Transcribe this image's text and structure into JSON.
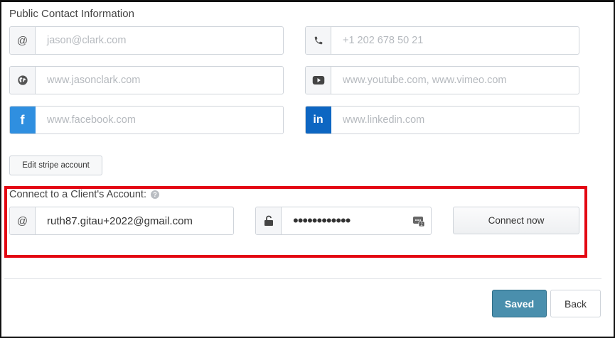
{
  "public_contact": {
    "title": "Public Contact Information",
    "email_placeholder": "jason@clark.com",
    "phone_placeholder": "+1 202 678 50 21",
    "website_placeholder": "www.jasonclark.com",
    "video_placeholder": "www.youtube.com, www.vimeo.com",
    "facebook_placeholder": "www.facebook.com",
    "linkedin_placeholder": "www.linkedin.com",
    "icons": {
      "email": "at-icon",
      "phone": "phone-icon",
      "website": "globe-icon",
      "video": "youtube-icon",
      "facebook": "facebook-icon",
      "linkedin": "linkedin-icon"
    }
  },
  "stripe": {
    "edit_label": "Edit stripe account"
  },
  "connect": {
    "label": "Connect to a Client's Account:",
    "help_icon": "question-icon",
    "email_value": "ruth87.gitau+2022@gmail.com",
    "password_value": "••••••••••••",
    "connect_label": "Connect now",
    "highlight_color": "#e30613"
  },
  "footer": {
    "saved_label": "Saved",
    "back_label": "Back",
    "saved_color": "#4a8fad"
  },
  "glyphs": {
    "at": "@",
    "facebook": "f",
    "linkedin": "in",
    "help": "?"
  }
}
